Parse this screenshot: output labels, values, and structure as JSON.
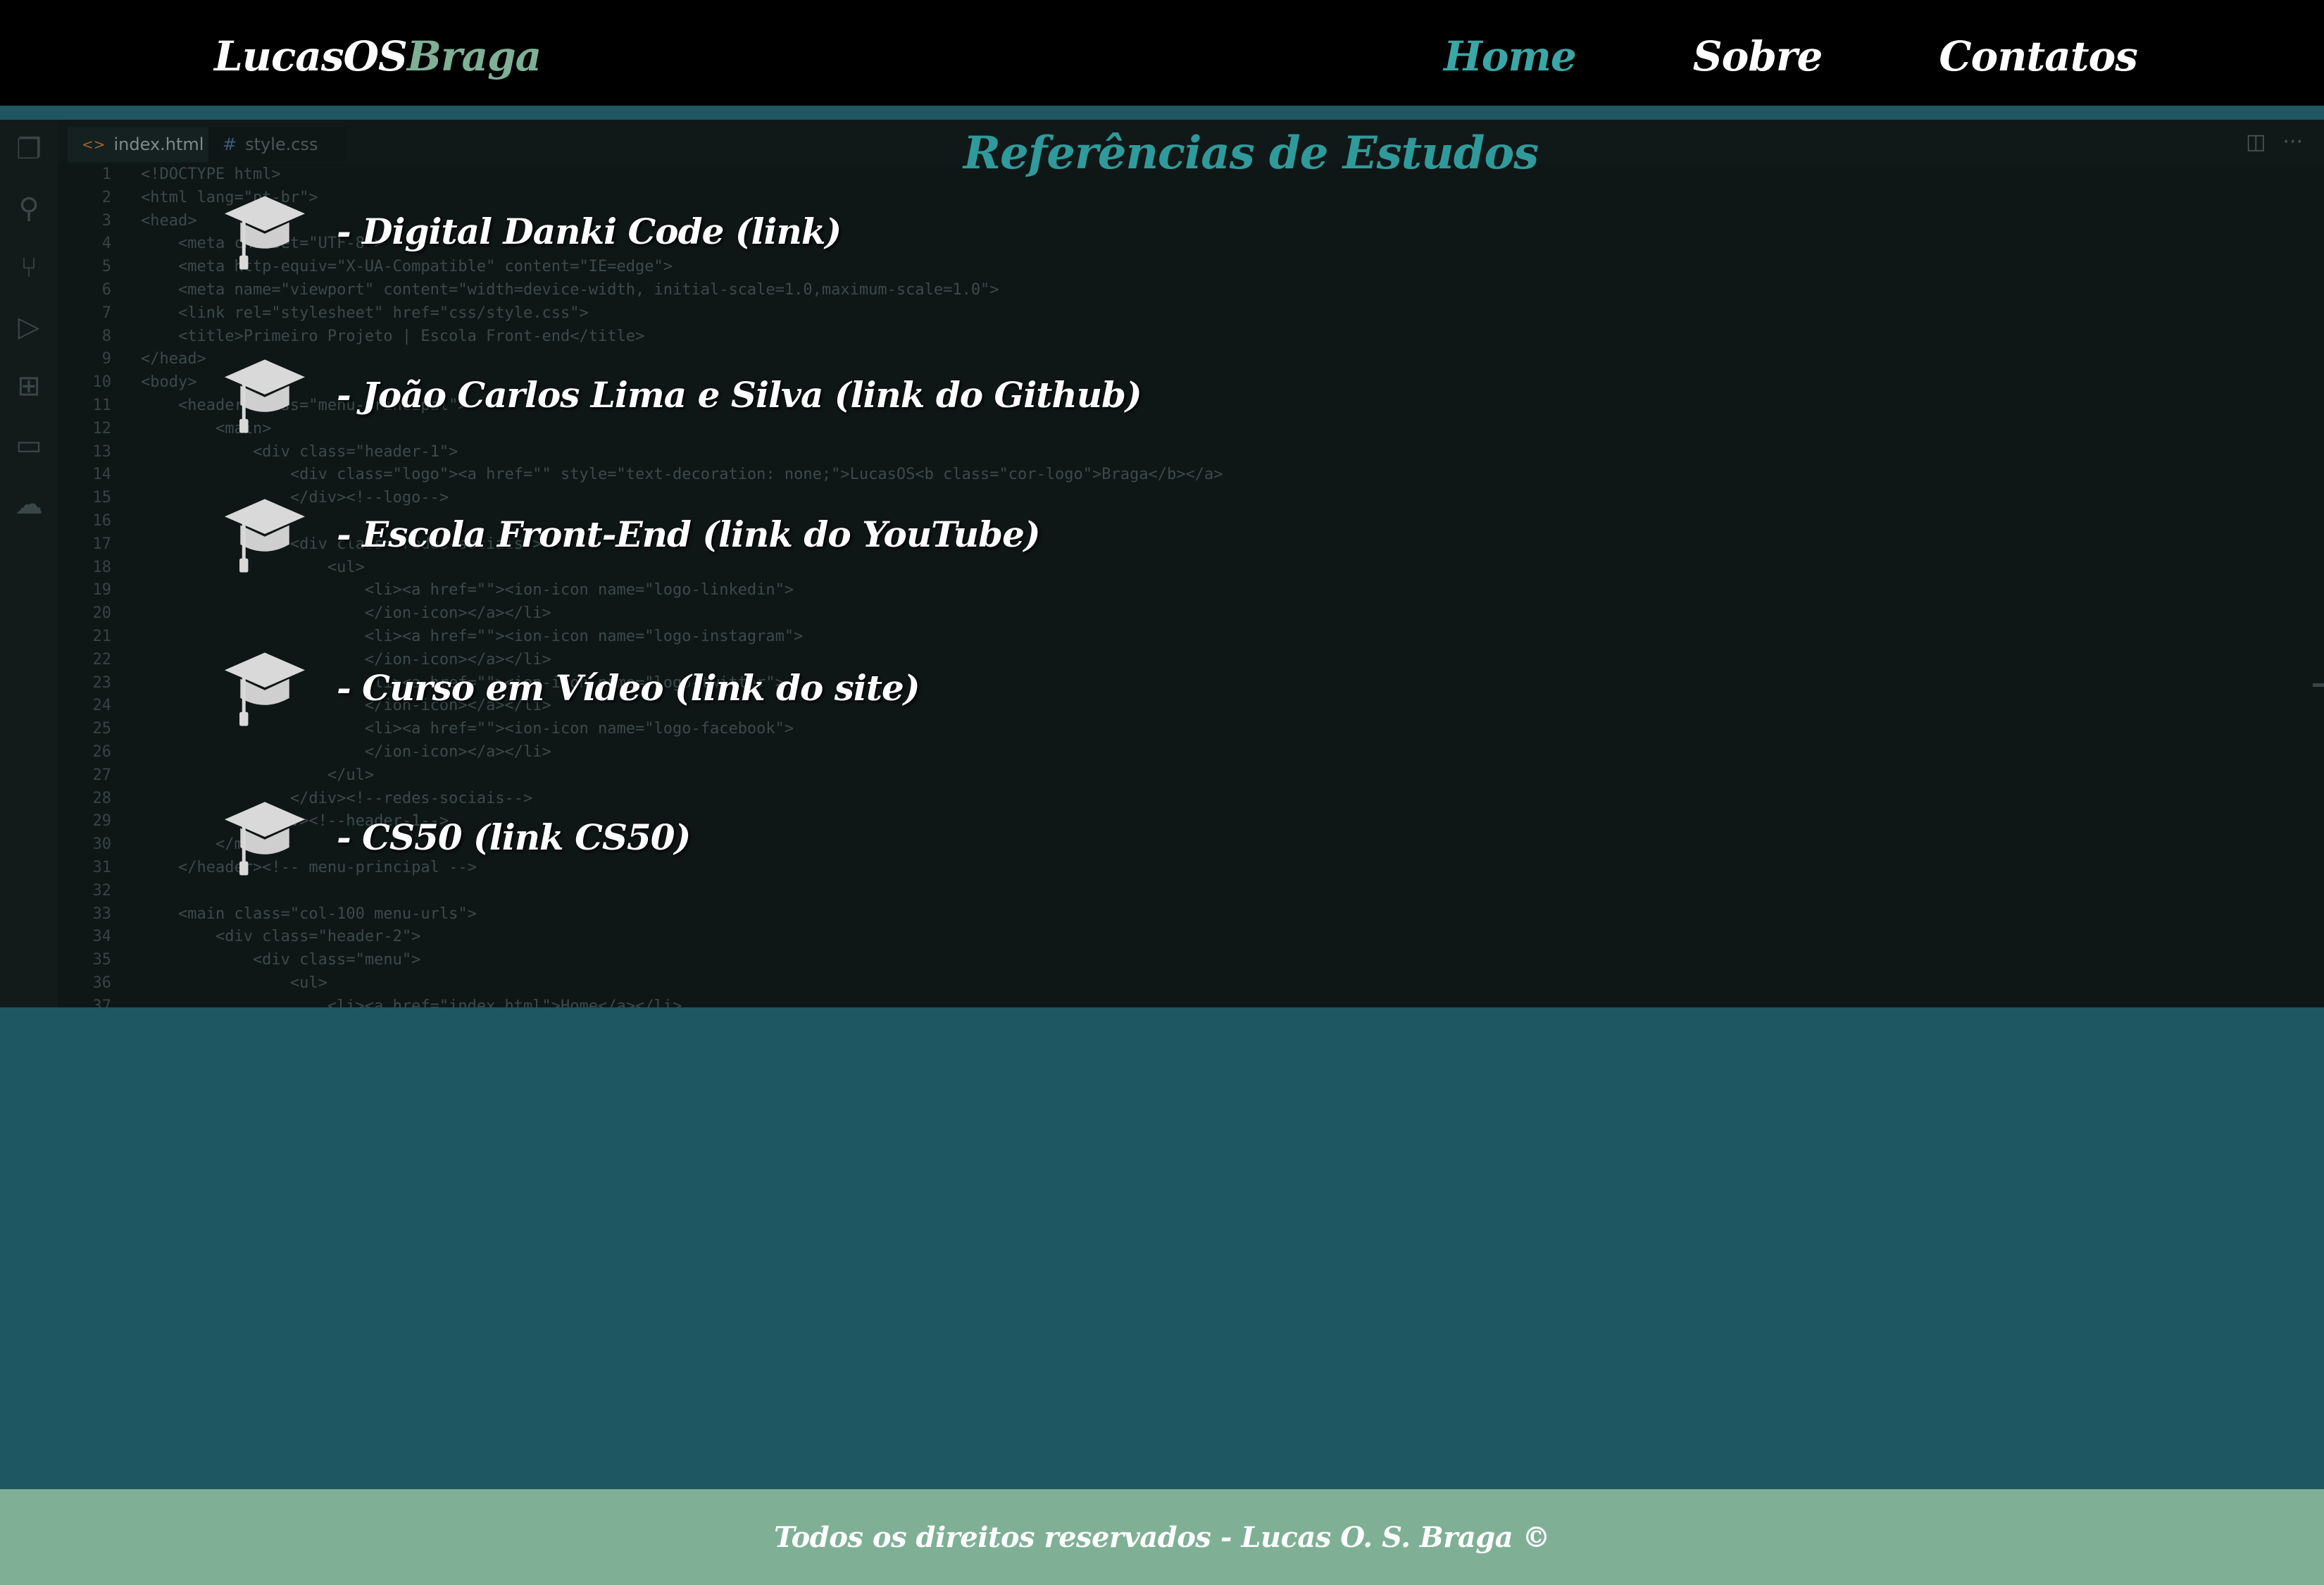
{
  "header": {
    "logo_main": "LucasOS",
    "logo_accent": "Braga",
    "nav": [
      {
        "label": "Home",
        "active": true
      },
      {
        "label": "Sobre",
        "active": false
      },
      {
        "label": "Contatos",
        "active": false
      }
    ]
  },
  "editor": {
    "tabs": [
      {
        "icon": "<>",
        "label": "index.html",
        "close": "✕"
      },
      {
        "icon": "#",
        "label": "style.css"
      }
    ],
    "actions": [
      "split-editor-icon",
      "more-icon"
    ],
    "line_numbers": [
      "1",
      "2",
      "3",
      "4",
      "5",
      "6",
      "7",
      "8",
      "9",
      "10",
      "11",
      "12",
      "13",
      "14",
      "15",
      "16",
      "17",
      "18",
      "19",
      "20",
      "21",
      "22",
      "23",
      "24",
      "25",
      "26",
      "27",
      "28",
      "29",
      "30",
      "31",
      "32",
      "33",
      "34",
      "35",
      "36",
      "37"
    ],
    "code_lines": [
      "<!DOCTYPE html>",
      "<html lang=\"pt-br\">",
      "<head>",
      "    <meta charset=\"UTF-8\">",
      "    <meta http-equiv=\"X-UA-Compatible\" content=\"IE=edge\">",
      "    <meta name=\"viewport\" content=\"width=device-width, initial-scale=1.0,maximum-scale=1.0\">",
      "    <link rel=\"stylesheet\" href=\"css/style.css\">",
      "    <title>Primeiro Projeto | Escola Front-end</title>",
      "</head>",
      "<body>",
      "    <header class=\"menu-principal\">",
      "        <main>",
      "            <div class=\"header-1\">",
      "                <div class=\"logo\"><a href=\"\" style=\"text-decoration: none;\">LucasOS<b class=\"cor-logo\">Braga</b></a>",
      "                </div><!--logo-->",
      "",
      "                <div class=\"redes-sociais\">",
      "                    <ul>",
      "                        <li><a href=\"\"><ion-icon name=\"logo-linkedin\">",
      "                        </ion-icon></a></li>",
      "                        <li><a href=\"\"><ion-icon name=\"logo-instagram\">",
      "                        </ion-icon></a></li>",
      "                        <li><a href=\"\"><ion-icon name=\"logo-twitter\">",
      "                        </ion-icon></a></li>",
      "                        <li><a href=\"\"><ion-icon name=\"logo-facebook\">",
      "                        </ion-icon></a></li>",
      "                    </ul>",
      "                </div><!--redes-sociais-->",
      "            </div><!--header-1-->",
      "        </main>",
      "    </header><!-- menu-principal -->",
      "",
      "    <main class=\"col-100 menu-urls\">",
      "        <div class=\"header-2\">",
      "            <div class=\"menu\">",
      "                <ul>",
      "                    <li><a href=\"index.html\">Home</a></li>"
    ]
  },
  "hero": {
    "title": "Referências de Estudos",
    "references": [
      {
        "label": "- Digital Danki Code (link)"
      },
      {
        "label": "- João Carlos Lima e Silva (link do Github)"
      },
      {
        "label": "- Escola Front-End (link do YouTube)"
      },
      {
        "label": "- Curso em Vídeo (link do site)"
      },
      {
        "label": "- CS50 (link CS50)"
      }
    ],
    "icon": "graduation-cap-icon"
  },
  "footer": {
    "text": "Todos os direitos reservados - Lucas O. S. Braga ©"
  },
  "colors": {
    "header_bg": "#000000",
    "accent_teal": "#3aa6a6",
    "logo_accent": "#7fb096",
    "page_bg": "#1e5662",
    "footer_bg": "#7fb096"
  }
}
